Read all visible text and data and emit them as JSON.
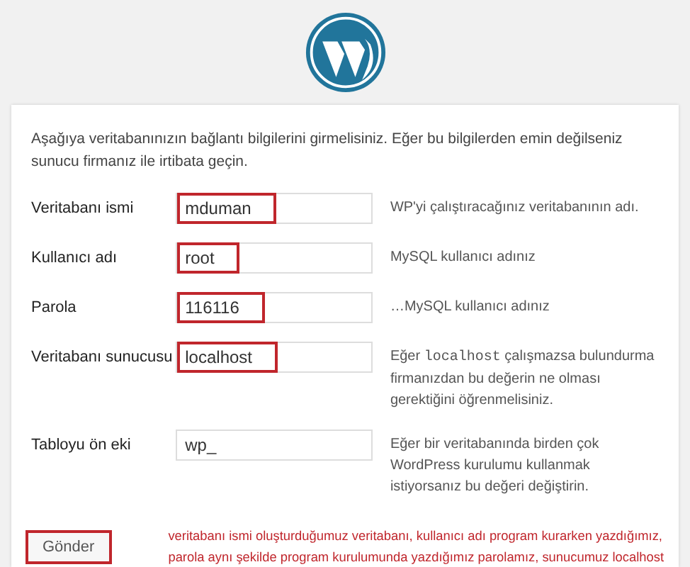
{
  "intro": "Aşağıya veritabanınızın bağlantı bilgilerini girmelisiniz. Eğer bu bilgilerden emin değilseniz sunucu firmanız ile irtibata geçin.",
  "fields": [
    {
      "label": "Veritabanı ismi",
      "value": "mduman",
      "highlighted": true,
      "help": [
        {
          "text": "WP'yi çalıştıracağınız veritabanının adı.",
          "mono": false
        }
      ]
    },
    {
      "label": "Kullanıcı adı",
      "value": "root",
      "highlighted": true,
      "help": [
        {
          "text": "MySQL kullanıcı adınız",
          "mono": false
        }
      ]
    },
    {
      "label": "Parola",
      "value": "116116",
      "highlighted": true,
      "help": [
        {
          "text": "…MySQL kullanıcı adınız",
          "mono": false
        }
      ]
    },
    {
      "label": "Veritabanı sunucusu",
      "value": "localhost",
      "highlighted": true,
      "help": [
        {
          "text": "Eğer ",
          "mono": false
        },
        {
          "text": "localhost",
          "mono": true
        },
        {
          "text": " çalışmazsa bulundurma firmanızdan bu değerin ne olması gerektiğini öğrenmelisiniz.",
          "mono": false
        }
      ]
    },
    {
      "label": "Tabloyu ön eki",
      "value": "wp_",
      "highlighted": false,
      "help": [
        {
          "text": "Eğer bir veritabanında birden çok WordPress kurulumu kullanmak istiyorsanız bu değeri değiştirin.",
          "mono": false
        }
      ]
    }
  ],
  "submit": {
    "label": "Gönder",
    "highlighted": true
  },
  "note_lines": [
    "veritabanı ismi oluşturduğumuz veritabanı, kullanıcı adı program kurarken yazdığımız,",
    "parola aynı şekilde program kurulumunda yazdığımız parolamız, sunucumuz localhost"
  ]
}
